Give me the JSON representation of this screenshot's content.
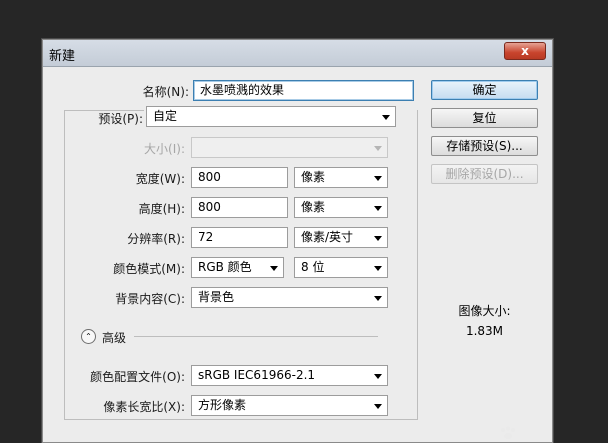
{
  "window": {
    "title": "新建",
    "close_glyph": "x"
  },
  "form": {
    "name": {
      "label": "名称(N):",
      "value": "水墨喷溅的效果"
    },
    "preset": {
      "label": "预设(P):",
      "value": "自定"
    },
    "size": {
      "label": "大小(I):",
      "value": ""
    },
    "width": {
      "label": "宽度(W):",
      "value": "800",
      "unit": "像素"
    },
    "height": {
      "label": "高度(H):",
      "value": "800",
      "unit": "像素"
    },
    "resolution": {
      "label": "分辨率(R):",
      "value": "72",
      "unit": "像素/英寸"
    },
    "color_mode": {
      "label": "颜色模式(M):",
      "value": "RGB 颜色",
      "depth": "8 位"
    },
    "background": {
      "label": "背景内容(C):",
      "value": "背景色"
    },
    "advanced": {
      "label": "高级",
      "toggle_glyph": "⌃"
    },
    "color_profile": {
      "label": "颜色配置文件(O):",
      "value": "sRGB IEC61966-2.1"
    },
    "pixel_aspect": {
      "label": "像素长宽比(X):",
      "value": "方形像素"
    }
  },
  "buttons": {
    "ok": "确定",
    "reset": "复位",
    "save_preset": "存储预设(S)...",
    "delete_preset": "删除预设(D)..."
  },
  "image_size": {
    "label": "图像大小:",
    "value": "1.83M"
  },
  "colors": {
    "focus": "#3c7fb1",
    "close": "#c8442d",
    "background": "#262626"
  }
}
